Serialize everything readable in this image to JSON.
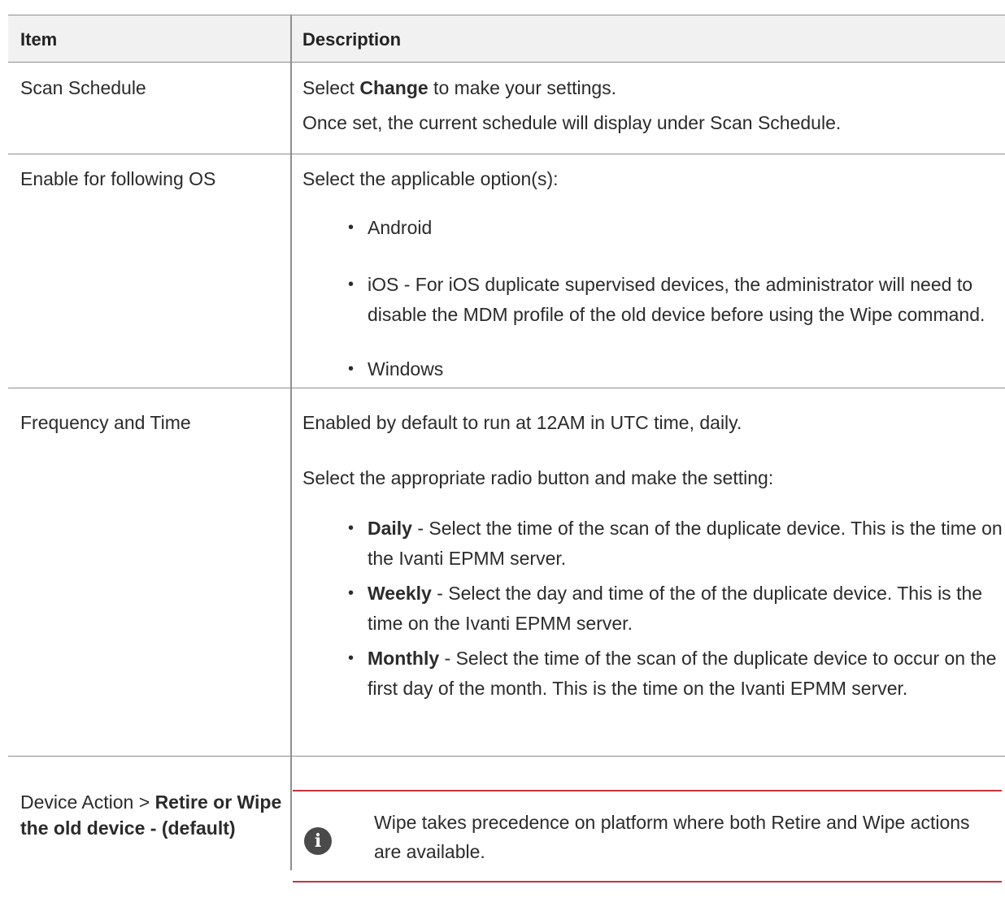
{
  "table": {
    "headers": {
      "item": "Item",
      "description": "Description"
    },
    "scan_schedule": {
      "item": "Scan Schedule",
      "desc_line1_pre": "Select ",
      "desc_line1_bold": "Change",
      "desc_line1_post": " to make your settings.",
      "desc_line2": "Once set, the current schedule will display under Scan Schedule."
    },
    "os": {
      "item": "Enable for following OS",
      "intro": "Select the applicable option(s):",
      "options": [
        "Android",
        "iOS - For iOS duplicate supervised devices, the administrator will need to disable the MDM profile of the old device before using the Wipe command.",
        "Windows"
      ]
    },
    "frequency": {
      "item": "Frequency and Time",
      "para1": "Enabled by default to run at 12AM in UTC time, daily.",
      "para2": "Select the appropriate radio button and make the setting:",
      "options": [
        {
          "label": "Daily",
          "text": " - Select the time of the scan of the duplicate device. This is the time on the Ivanti EPMM server."
        },
        {
          "label": "Weekly",
          "text": " - Select the day and time of the of the duplicate device. This is the time on the Ivanti EPMM server."
        },
        {
          "label": "Monthly",
          "text": " - Select the time of the scan of the duplicate device to occur on the first day of the month. This is the time on the Ivanti EPMM server."
        }
      ]
    },
    "device_action": {
      "item_pre": "Device Action > ",
      "item_bold": "Retire or Wipe the old device - (default)",
      "note": "Wipe takes precedence on platform where both Retire and Wipe actions are available.",
      "note_icon": "info-icon"
    }
  }
}
